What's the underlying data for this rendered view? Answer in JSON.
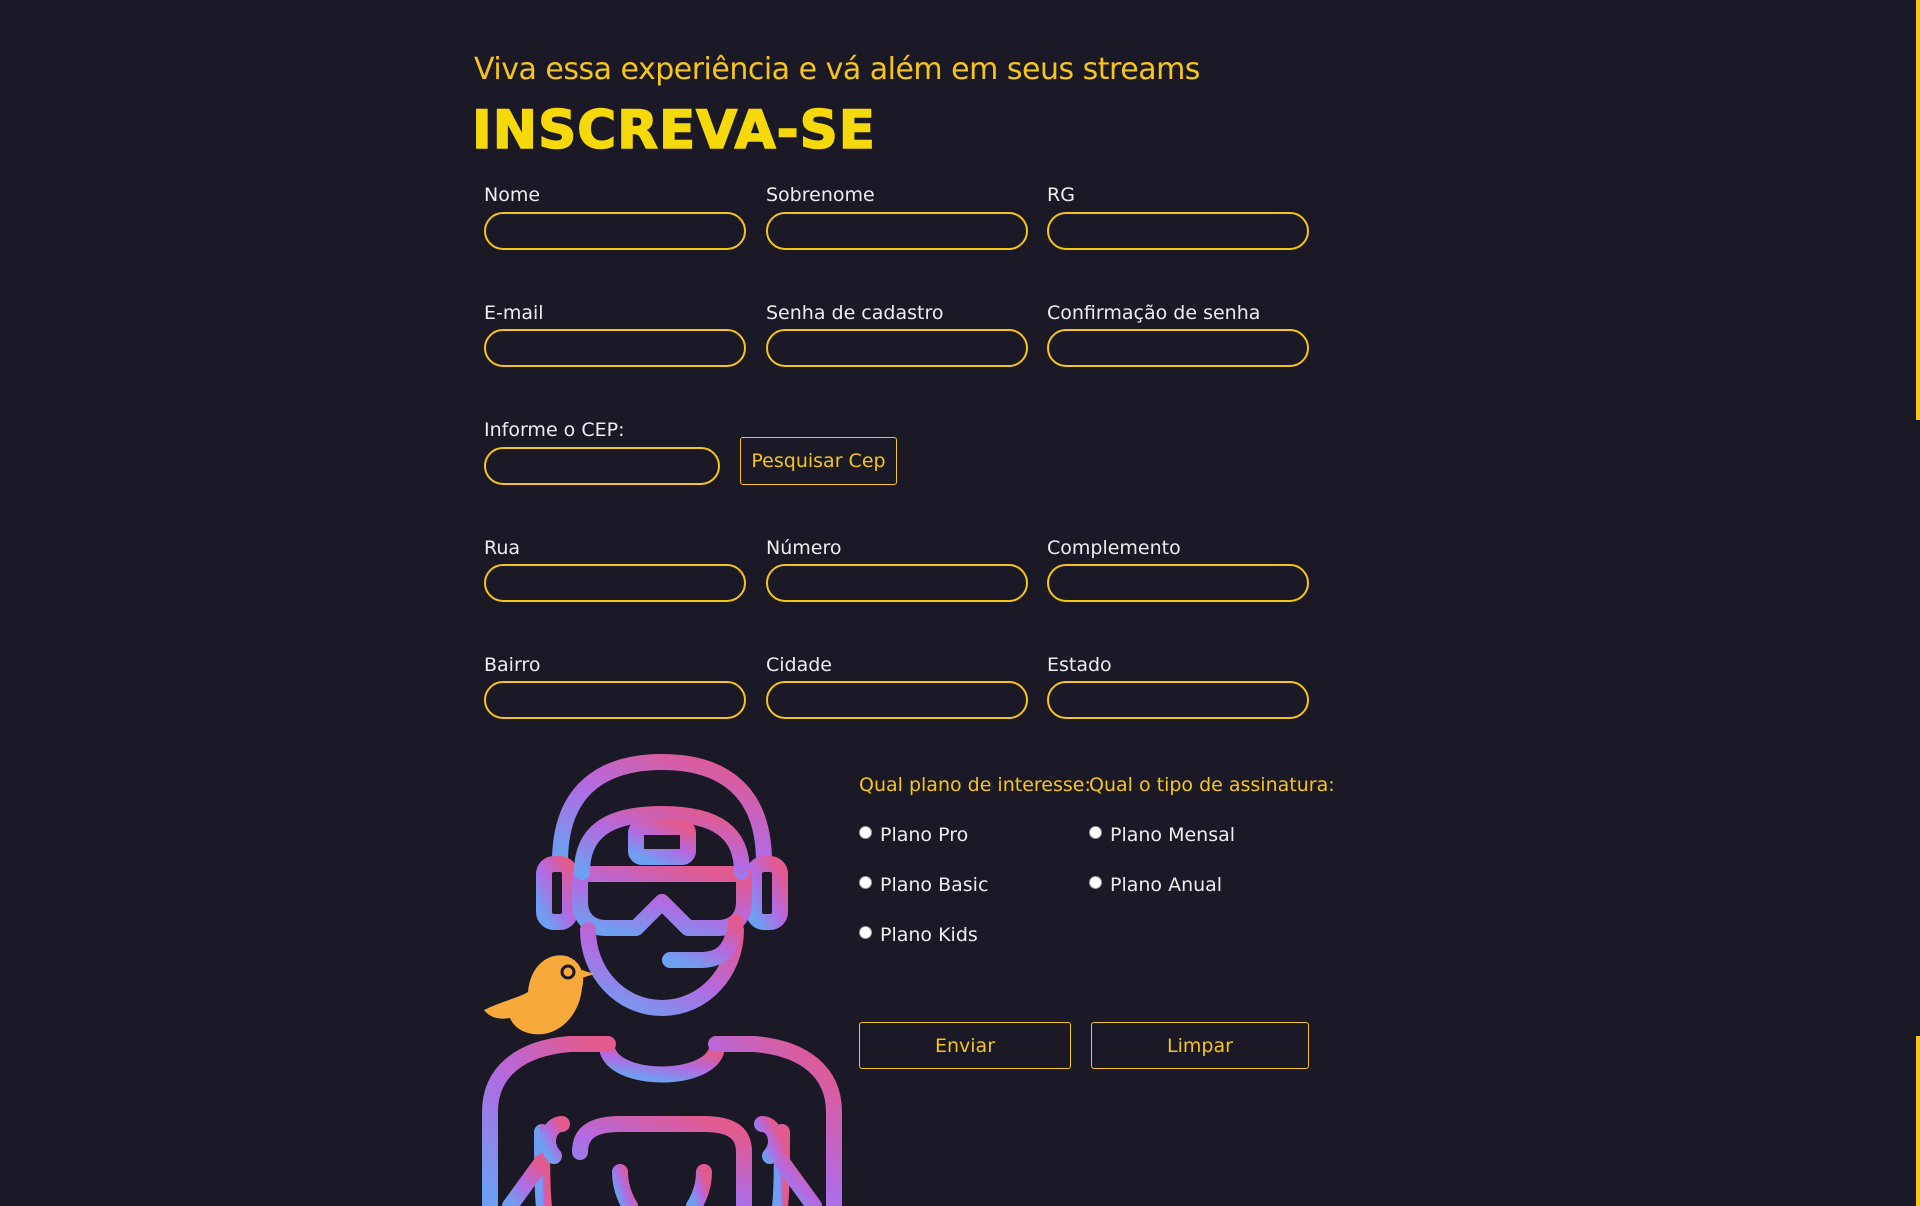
{
  "header": {
    "subtitle": "Viva essa experiência e vá além em seus streams",
    "title": "INSCREVA-SE"
  },
  "form": {
    "fields": {
      "nome": {
        "label": "Nome",
        "value": "",
        "placeholder": ""
      },
      "sobrenome": {
        "label": "Sobrenome",
        "value": "",
        "placeholder": ""
      },
      "rg": {
        "label": "RG",
        "value": "",
        "placeholder": ""
      },
      "email": {
        "label": "E-mail",
        "value": "",
        "placeholder": ""
      },
      "senha": {
        "label": "Senha de cadastro",
        "value": "",
        "placeholder": ""
      },
      "confirmacao": {
        "label": "Confirmação de senha",
        "value": "",
        "placeholder": ""
      },
      "cep": {
        "label": "Informe o CEP:",
        "value": "",
        "placeholder": ""
      },
      "rua": {
        "label": "Rua",
        "value": "",
        "placeholder": ""
      },
      "numero": {
        "label": "Número",
        "value": "",
        "placeholder": ""
      },
      "complemento": {
        "label": "Complemento",
        "value": "",
        "placeholder": ""
      },
      "bairro": {
        "label": "Bairro",
        "value": "",
        "placeholder": ""
      },
      "cidade": {
        "label": "Cidade",
        "value": "",
        "placeholder": ""
      },
      "estado": {
        "label": "Estado",
        "value": "",
        "placeholder": ""
      }
    },
    "search_cep_label": "Pesquisar Cep",
    "plan_question": "Qual plano de interesse:",
    "plans": [
      "Plano Pro",
      "Plano Basic",
      "Plano Kids"
    ],
    "subscription_question": "Qual o tipo de assinatura:",
    "subscriptions": [
      "Plano Mensal",
      "Plano Anual"
    ],
    "submit_label": "Enviar",
    "reset_label": "Limpar"
  },
  "illustration": {
    "icon": "gamer-with-vr-headset-and-bird-icon"
  },
  "colors": {
    "background": "#1b1926",
    "accent": "#f5c518",
    "title": "#f5d90a",
    "text": "#ededed",
    "gradient_pink": "#e25a8e",
    "gradient_purple": "#b36ae2",
    "gradient_blue": "#6e9ff0",
    "bird": "#f7a93b"
  }
}
